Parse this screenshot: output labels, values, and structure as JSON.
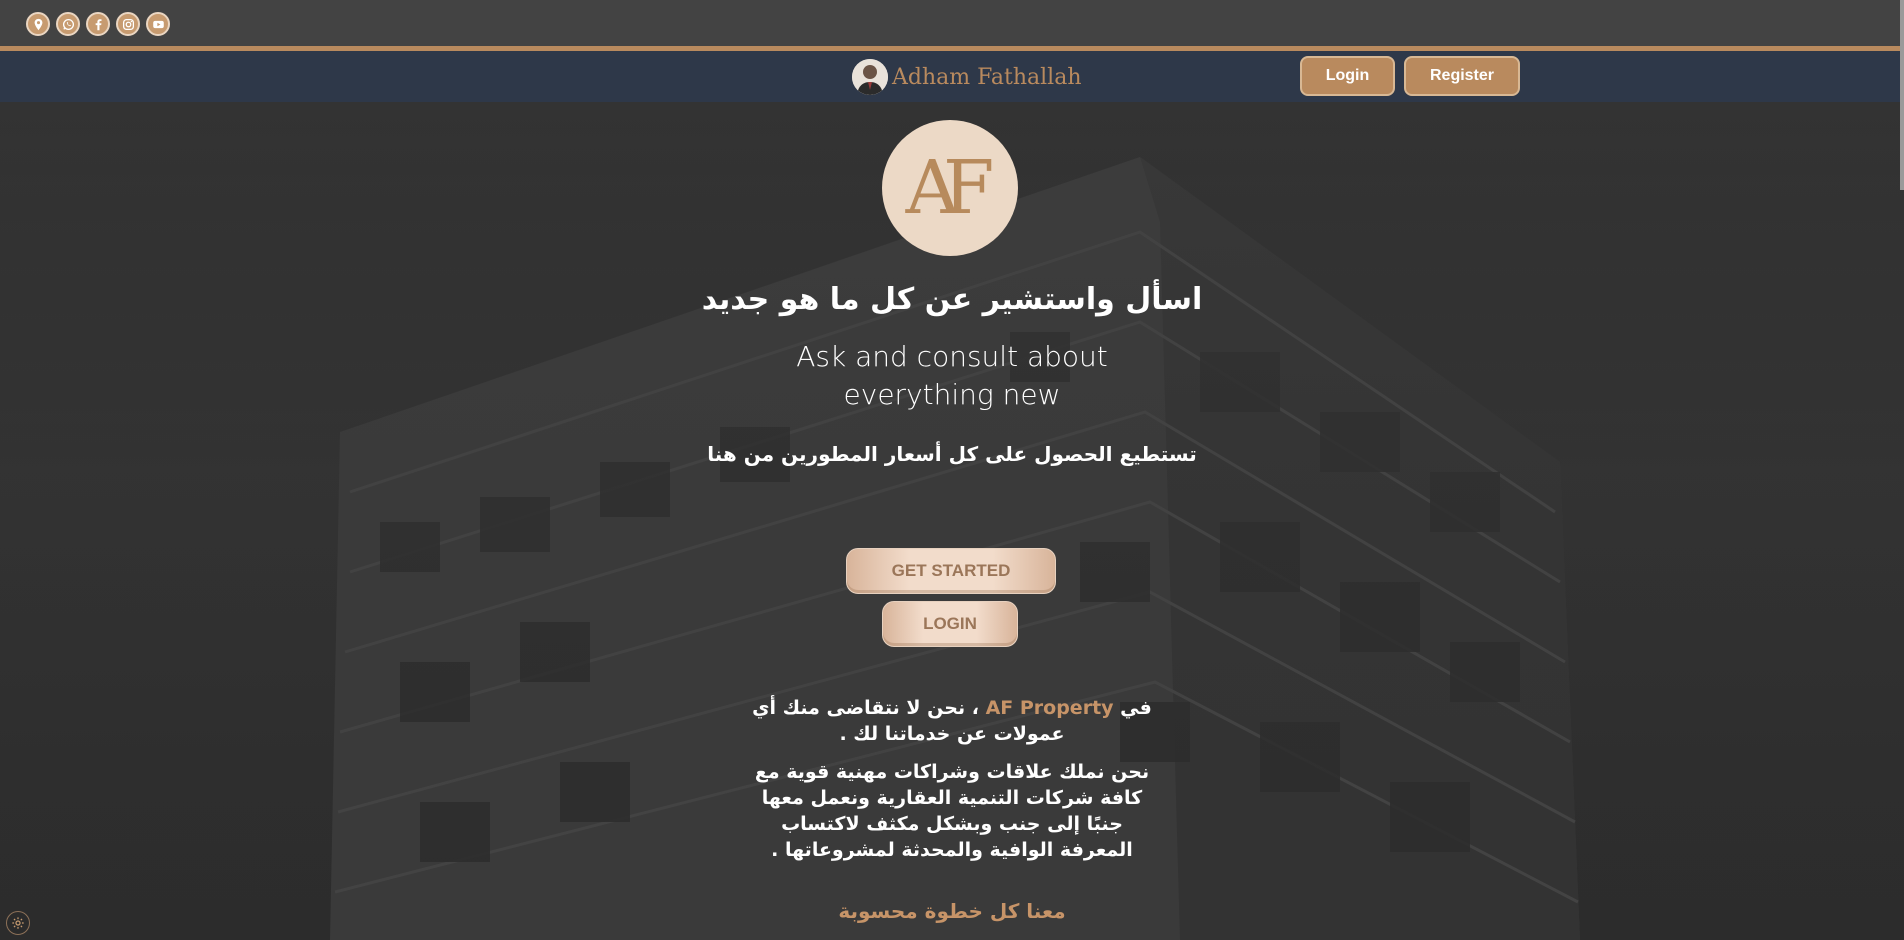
{
  "social": {
    "items": [
      {
        "icon": "location-pin-icon"
      },
      {
        "icon": "whatsapp-icon"
      },
      {
        "icon": "facebook-icon"
      },
      {
        "icon": "instagram-icon"
      },
      {
        "icon": "youtube-icon"
      }
    ]
  },
  "navbar": {
    "brand_name": "Adham Fathallah",
    "login_label": "Login",
    "register_label": "Register"
  },
  "hero": {
    "logo_text": "AF",
    "heading_arabic": "اسأل واستشير عن كل ما هو جديد",
    "heading_english": "Ask and consult about everything new",
    "sub_arabic": "تستطيع الحصول على كل أسعار المطورين من هنا",
    "get_started_label": "GET STARTED",
    "login_label": "LOGIN",
    "para1_prefix": "في",
    "para1_brand": "AF Property",
    "para1_rest": "، نحن لا نتقاضى منك أي عمولات عن خدماتنا لك .",
    "para2": "نحن نملك علاقات وشراكات مهنية قوية مع كافة شركات التنمية العقارية ونعمل معها جنبًا إلى جنب وبشكل مكثف لاكتساب المعرفة الوافية والمحدثة لمشروعاتها .",
    "tagline": "معنا كل خطوة محسوبة"
  },
  "colors": {
    "accent": "#b98a5e",
    "navbar_bg": "#2e3849",
    "topbar_bg": "#434343"
  }
}
